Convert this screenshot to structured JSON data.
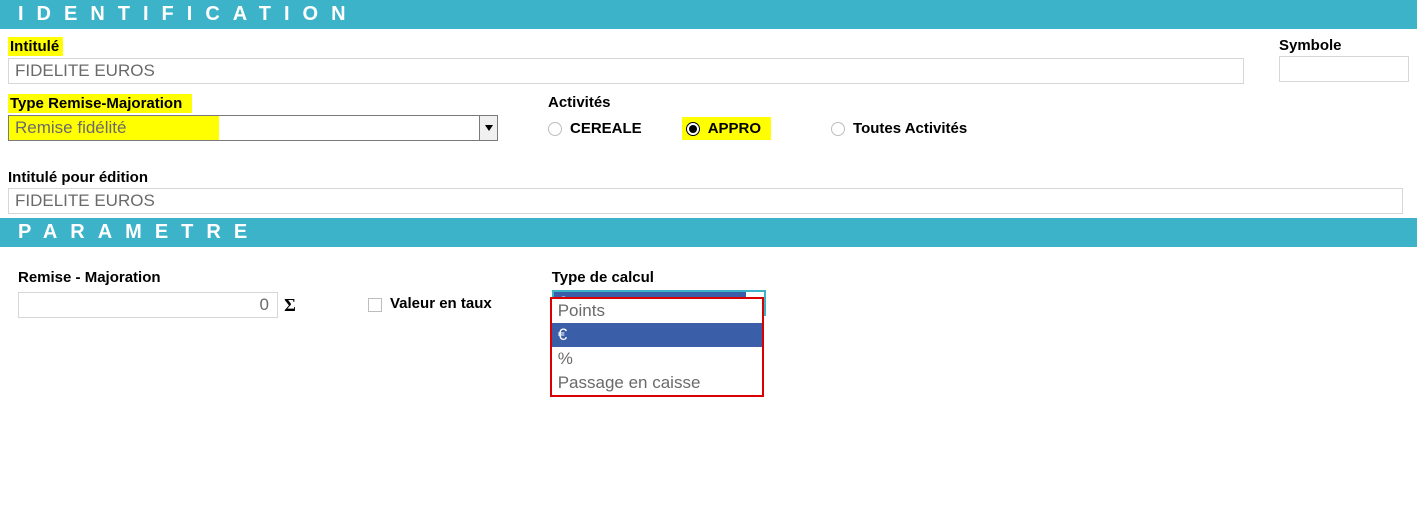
{
  "sections": {
    "identification": "IDENTIFICATION",
    "parametre": "PARAMETRE"
  },
  "identification": {
    "intitule_label": "Intitulé",
    "intitule_value": "FIDELITE EUROS",
    "symbole_label": "Symbole",
    "symbole_value": "",
    "type_rm_label": "Type Remise-Majoration",
    "type_rm_value": "Remise fidélité",
    "activites_label": "Activités",
    "activites": {
      "cereale": "CEREALE",
      "appro": "APPRO",
      "toutes": "Toutes Activités",
      "selected": "appro"
    },
    "intitule_edition_label": "Intitulé pour édition",
    "intitule_edition_value": "FIDELITE EUROS"
  },
  "parametre": {
    "remise_majoration_label": "Remise - Majoration",
    "remise_majoration_value": "0",
    "valeur_taux_label": "Valeur en taux",
    "type_calcul_label": "Type de calcul",
    "type_calcul_value": "€",
    "type_calcul_options": [
      "Points",
      "€",
      "%",
      "Passage en caisse"
    ],
    "type_calcul_selected_index": 1
  }
}
